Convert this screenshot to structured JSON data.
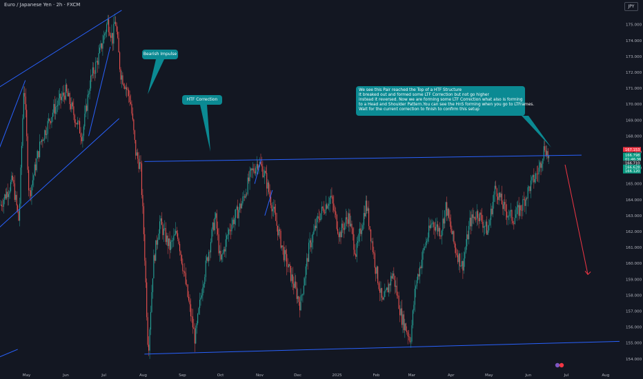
{
  "header": {
    "symbol_title": "Euro / Japanese Yen · 2h · FXCM",
    "currency": "JPY"
  },
  "annotations": {
    "bearish_impulse": "Bearish Impulse",
    "htf_correction": "HTF Correction",
    "main_note": [
      "We see this Pair reached the Top of a HTF Structure",
      "It breaked out and formed some LTF Correction but not go higher",
      "instead it reversed. Now we are forming some LTF Correction what also is forming",
      "to a Head and Shoulder Pattern.You can see the HnS forming when you go to LTFrames.",
      "Wait for the current correction to finish to confirm this setup"
    ]
  },
  "price_tags": [
    {
      "label": "167.153",
      "value": 167.153,
      "color": "#f23645"
    },
    {
      "label": "166.798",
      "value": 166.8,
      "color": "#089981"
    },
    {
      "label": "01:46:36",
      "value": 166.55,
      "color": "#089981"
    },
    {
      "label": "166.710",
      "value": 166.3,
      "color": "#2a2e39"
    },
    {
      "label": "166.628",
      "value": 166.05,
      "color": "#089981"
    },
    {
      "label": "166.120",
      "value": 165.8,
      "color": "#089981"
    }
  ],
  "colors": {
    "background": "#131722",
    "up": "#26a69a",
    "down": "#ef5350",
    "drawing": "#2962ff",
    "arrow": "#f23645",
    "note": "#0b8a93",
    "grid": "#1e222d"
  },
  "chart_data": {
    "type": "candlestick",
    "title": "Euro / Japanese Yen · 2h · FXCM",
    "unit": "JPY",
    "ylim": [
      153.6,
      176.2
    ],
    "y_ticks": [
      "175.000",
      "174.000",
      "173.000",
      "172.000",
      "171.000",
      "170.000",
      "169.000",
      "168.000",
      "167.000",
      "166.000",
      "165.000",
      "164.000",
      "163.000",
      "162.000",
      "161.000",
      "160.000",
      "159.000",
      "158.000",
      "157.000",
      "156.000",
      "155.000",
      "154.000"
    ],
    "x_ticks": [
      "May",
      "Jun",
      "Jul",
      "Aug",
      "Sep",
      "Oct",
      "Nov",
      "Dec",
      "2025",
      "Feb",
      "Mar",
      "Apr",
      "May",
      "Jun",
      "Jul",
      "Aug"
    ],
    "x_domain": [
      "2024-04-10",
      "2025-08-12"
    ],
    "grid": false,
    "swing_path": [
      [
        "2024-04-10",
        163.6
      ],
      [
        "2024-04-20",
        165.2
      ],
      [
        "2024-04-25",
        162.6
      ],
      [
        "2024-04-29",
        171.6
      ],
      [
        "2024-05-03",
        164.2
      ],
      [
        "2024-05-12",
        167.6
      ],
      [
        "2024-05-22",
        169.6
      ],
      [
        "2024-06-01",
        170.8
      ],
      [
        "2024-06-08",
        169.2
      ],
      [
        "2024-06-14",
        168.0
      ],
      [
        "2024-06-20",
        171.4
      ],
      [
        "2024-06-27",
        173.0
      ],
      [
        "2024-07-04",
        175.2
      ],
      [
        "2024-07-08",
        174.1
      ],
      [
        "2024-07-10",
        175.4
      ],
      [
        "2024-07-14",
        172.0
      ],
      [
        "2024-07-18",
        171.2
      ],
      [
        "2024-07-22",
        170.2
      ],
      [
        "2024-07-26",
        167.0
      ],
      [
        "2024-07-30",
        166.0
      ],
      [
        "2024-08-02",
        161.0
      ],
      [
        "2024-08-05",
        154.4
      ],
      [
        "2024-08-09",
        160.0
      ],
      [
        "2024-08-14",
        162.6
      ],
      [
        "2024-08-22",
        161.0
      ],
      [
        "2024-08-28",
        162.0
      ],
      [
        "2024-09-05",
        158.0
      ],
      [
        "2024-09-11",
        155.2
      ],
      [
        "2024-09-17",
        158.8
      ],
      [
        "2024-09-27",
        163.0
      ],
      [
        "2024-10-01",
        160.0
      ],
      [
        "2024-10-08",
        162.2
      ],
      [
        "2024-10-18",
        163.8
      ],
      [
        "2024-10-25",
        165.6
      ],
      [
        "2024-10-31",
        166.4
      ],
      [
        "2024-11-05",
        165.6
      ],
      [
        "2024-11-12",
        163.2
      ],
      [
        "2024-11-20",
        160.6
      ],
      [
        "2024-11-29",
        158.4
      ],
      [
        "2024-12-03",
        157.4
      ],
      [
        "2024-12-10",
        161.0
      ],
      [
        "2024-12-18",
        163.0
      ],
      [
        "2024-12-27",
        164.2
      ],
      [
        "2025-01-03",
        161.8
      ],
      [
        "2025-01-10",
        163.0
      ],
      [
        "2025-01-16",
        160.6
      ],
      [
        "2025-01-24",
        163.8
      ],
      [
        "2025-01-31",
        160.0
      ],
      [
        "2025-02-06",
        157.4
      ],
      [
        "2025-02-14",
        159.4
      ],
      [
        "2025-02-21",
        156.6
      ],
      [
        "2025-02-28",
        155.2
      ],
      [
        "2025-03-04",
        158.6
      ],
      [
        "2025-03-11",
        161.0
      ],
      [
        "2025-03-17",
        162.6
      ],
      [
        "2025-03-24",
        162.0
      ],
      [
        "2025-03-28",
        163.6
      ],
      [
        "2025-04-04",
        161.0
      ],
      [
        "2025-04-10",
        159.8
      ],
      [
        "2025-04-16",
        162.6
      ],
      [
        "2025-04-22",
        163.2
      ],
      [
        "2025-04-30",
        162.0
      ],
      [
        "2025-05-06",
        164.8
      ],
      [
        "2025-05-13",
        163.4
      ],
      [
        "2025-05-20",
        162.8
      ],
      [
        "2025-05-27",
        163.6
      ],
      [
        "2025-06-02",
        164.8
      ],
      [
        "2025-06-09",
        165.8
      ],
      [
        "2025-06-14",
        167.4
      ],
      [
        "2025-06-17",
        166.6
      ],
      [
        "2025-06-18",
        166.7
      ]
    ],
    "drawings": {
      "rising_wedge_upper": [
        [
          "2024-04-06",
          170.9
        ],
        [
          "2024-07-15",
          175.9
        ]
      ],
      "rising_wedge_lower": [
        [
          "2024-04-06",
          162.0
        ],
        [
          "2024-07-13",
          169.1
        ]
      ],
      "top_resistance": [
        [
          "2024-08-02",
          166.4
        ],
        [
          "2025-07-13",
          166.8
        ]
      ],
      "range_support": [
        [
          "2024-08-02",
          154.3
        ],
        [
          "2025-08-12",
          155.1
        ]
      ],
      "impulse_up_lines": [
        [
          [
            "2024-04-06",
            166.5
          ],
          [
            "2024-04-30",
            171.5
          ]
        ],
        [
          [
            "2024-06-19",
            168.0
          ],
          [
            "2024-07-06",
            173.6
          ]
        ],
        [
          [
            "2024-04-06",
            154.0
          ],
          [
            "2024-04-24",
            154.6
          ]
        ]
      ],
      "ltf_correction_lines": [
        [
          [
            "2024-10-28",
            165.0
          ],
          [
            "2024-11-02",
            166.5
          ]
        ],
        [
          [
            "2024-11-05",
            163.0
          ],
          [
            "2024-11-11",
            164.6
          ]
        ]
      ],
      "projection_arrow": [
        [
          "2025-06-30",
          166.2
        ],
        [
          "2025-07-18",
          159.3
        ]
      ]
    }
  }
}
